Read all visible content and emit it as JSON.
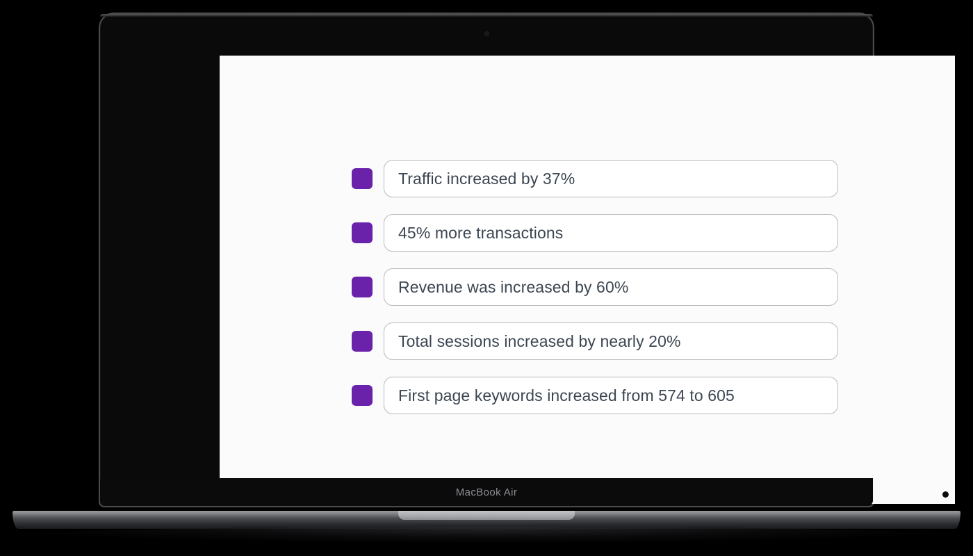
{
  "device": {
    "model_label": "MacBook Air",
    "camera_icon": "camera-dot-icon"
  },
  "theme": {
    "marker_color": "#6a22aa",
    "text_color": "#3c4652",
    "box_border_color": "#b9bbbd",
    "screen_background": "#fbfbfc",
    "page_background": "#000000"
  },
  "slide": {
    "bullets": [
      {
        "marker_icon": "purple-square-bullet-icon",
        "text": "Traffic increased by 37%"
      },
      {
        "marker_icon": "purple-square-bullet-icon",
        "text": "45% more transactions"
      },
      {
        "marker_icon": "purple-square-bullet-icon",
        "text": "Revenue was increased by 60%"
      },
      {
        "marker_icon": "purple-square-bullet-icon",
        "text": "Total sessions increased by nearly 20%"
      },
      {
        "marker_icon": "purple-square-bullet-icon",
        "text": "First page keywords increased from 574 to 605"
      }
    ]
  }
}
